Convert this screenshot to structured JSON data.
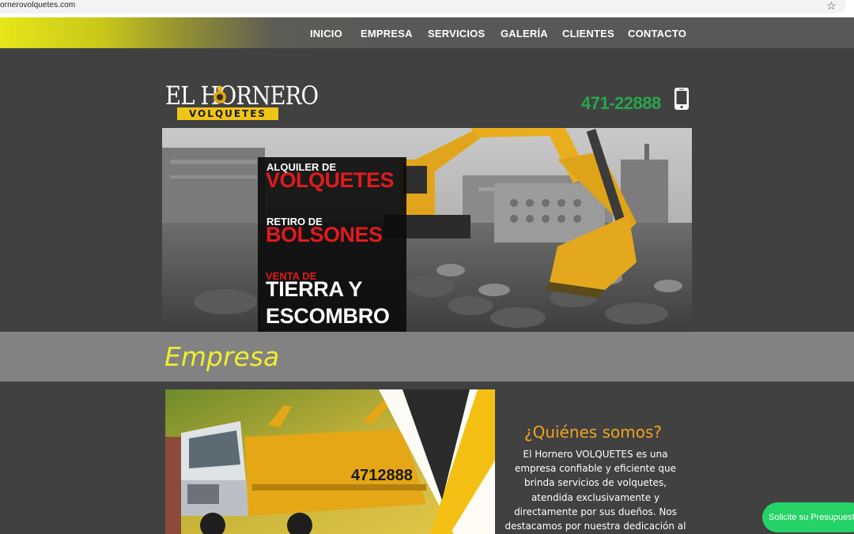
{
  "browser": {
    "url": "ornerovolquetes.com",
    "bookmark_icon": "star-icon"
  },
  "nav": {
    "items": [
      "INICIO",
      "EMPRESA",
      "SERVICIOS",
      "GALERÍA",
      "CLIENTES",
      "CONTACTO"
    ]
  },
  "header": {
    "logo_text": "EL HORNERO",
    "logo_badge": "VOLQUETES",
    "phone": "471-22888",
    "phone_icon": "smartphone-icon"
  },
  "hero": {
    "line1_small": "ALQUILER DE",
    "line1_big": "VOLQUETES",
    "line2_small": "RETIRO DE",
    "line2_big": "BOLSONES",
    "line3_small": "VENTA DE",
    "line3_big_a": "TIERRA Y",
    "line3_big_b": "ESCOMBRO"
  },
  "section": {
    "title": "Empresa"
  },
  "about": {
    "title": "¿Quiénes somos?",
    "text": "El Hornero VOLQUETES es una empresa confiable y eficiente que brinda servicios de volquetes, atendida exclusivamente y directamente por sus dueños. Nos destacamos por nuestra dedicación al cliente y nuestro compromiso con la",
    "truck_phone": "4712888"
  },
  "cta": {
    "label": "Solicite su Presupuesto"
  },
  "colors": {
    "background": "#414141",
    "nav_gradient_start": "#e6e619",
    "phone": "#26a74a",
    "section_title": "#f0ee2e",
    "about_title": "#f0a31c",
    "hero_red": "#e01b1b",
    "cta": "#25d366"
  }
}
